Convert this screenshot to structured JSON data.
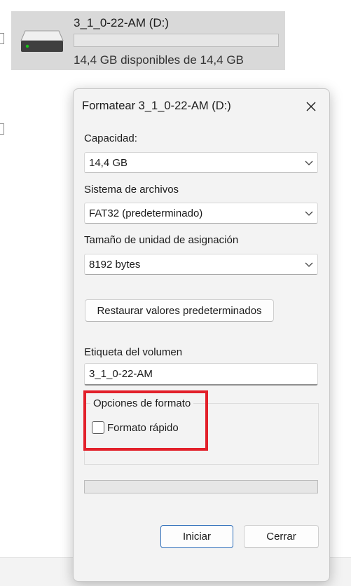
{
  "drive": {
    "name": "3_1_0-22-AM (D:)",
    "space_text": "14,4 GB disponibles de 14,4 GB",
    "used_fraction": 0,
    "icon": "drive-icon"
  },
  "dialog": {
    "title": "Formatear 3_1_0-22-AM (D:)",
    "close_icon": "close-icon",
    "capacity": {
      "label": "Capacidad:",
      "value": "14,4 GB"
    },
    "filesystem": {
      "label": "Sistema de archivos",
      "value": "FAT32 (predeterminado)"
    },
    "allocation": {
      "label": "Tamaño de unidad de asignación",
      "value": "8192 bytes"
    },
    "restore_button": "Restaurar valores predeterminados",
    "volume_label": {
      "label": "Etiqueta del volumen",
      "value": "3_1_0-22-AM"
    },
    "format_options": {
      "title": "Opciones de formato",
      "quick_format_label": "Formato rápido",
      "quick_format_checked": false
    },
    "progress_fraction": 0,
    "start_button": "Iniciar",
    "close_button": "Cerrar"
  },
  "colors": {
    "highlight": "#e2202a",
    "primary_button_border": "#2b6cb8",
    "drive_led": "#19c419"
  }
}
